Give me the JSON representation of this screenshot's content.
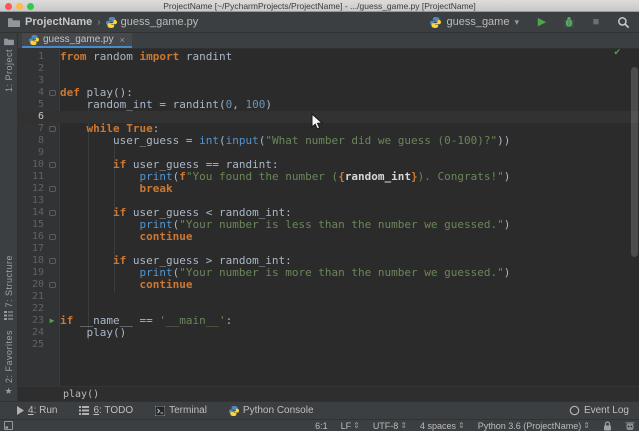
{
  "window": {
    "title": "ProjectName [~/PycharmProjects/ProjectName] - .../guess_game.py [ProjectName]"
  },
  "toolbar": {
    "project": "ProjectName",
    "separator": "›",
    "file": "guess_game.py",
    "run_config": "guess_game"
  },
  "tabs": [
    {
      "label": "guess_game.py"
    }
  ],
  "stripe_left": {
    "project": "1: Project",
    "structure": "7: Structure",
    "favorites": "2: Favorites"
  },
  "icons": {
    "play": "▶",
    "stop": "■",
    "dropdown": "▾",
    "close": "×",
    "check": "✔",
    "star": "★",
    "updown": "⇕"
  },
  "editor": {
    "current_line": 6,
    "gutter_marks": {
      "4": "fold",
      "7": "fold",
      "10": "fold",
      "12": "fold-end",
      "14": "fold",
      "16": "fold-end",
      "18": "fold",
      "20": "fold-end",
      "23": "run"
    },
    "lines": [
      {
        "n": 1,
        "seg": [
          [
            "k",
            "from"
          ],
          [
            "p",
            " random "
          ],
          [
            "k",
            "import"
          ],
          [
            "p",
            " randint"
          ]
        ]
      },
      {
        "n": 2,
        "seg": []
      },
      {
        "n": 3,
        "seg": []
      },
      {
        "n": 4,
        "seg": [
          [
            "k",
            "def"
          ],
          [
            "p",
            " play():"
          ]
        ]
      },
      {
        "n": 5,
        "seg": [
          [
            "p",
            "    random_int = randint("
          ],
          [
            "n",
            "0"
          ],
          [
            "p",
            ", "
          ],
          [
            "n",
            "100"
          ],
          [
            "p",
            ")"
          ]
        ]
      },
      {
        "n": 6,
        "seg": []
      },
      {
        "n": 7,
        "seg": [
          [
            "p",
            "    "
          ],
          [
            "k",
            "while"
          ],
          [
            "p",
            " "
          ],
          [
            "k",
            "True"
          ],
          [
            "p",
            ":"
          ]
        ]
      },
      {
        "n": 8,
        "seg": [
          [
            "p",
            "        user_guess = "
          ],
          [
            "b",
            "int"
          ],
          [
            "p",
            "("
          ],
          [
            "b",
            "input"
          ],
          [
            "p",
            "("
          ],
          [
            "s",
            "\"What number did we guess (0-100)?\""
          ],
          [
            "p",
            "))"
          ]
        ]
      },
      {
        "n": 9,
        "seg": []
      },
      {
        "n": 10,
        "seg": [
          [
            "p",
            "        "
          ],
          [
            "k",
            "if"
          ],
          [
            "p",
            " user_guess == randint:"
          ]
        ]
      },
      {
        "n": 11,
        "seg": [
          [
            "p",
            "            "
          ],
          [
            "b",
            "print"
          ],
          [
            "p",
            "("
          ],
          [
            "k",
            "f"
          ],
          [
            "s",
            "\"You found the number ("
          ],
          [
            "k",
            "{"
          ],
          [
            "e",
            "random_int"
          ],
          [
            "k",
            "}"
          ],
          [
            "s",
            "). Congrats!\""
          ],
          [
            "p",
            ")"
          ]
        ]
      },
      {
        "n": 12,
        "seg": [
          [
            "p",
            "            "
          ],
          [
            "k",
            "break"
          ]
        ]
      },
      {
        "n": 13,
        "seg": []
      },
      {
        "n": 14,
        "seg": [
          [
            "p",
            "        "
          ],
          [
            "k",
            "if"
          ],
          [
            "p",
            " user_guess < random_int:"
          ]
        ]
      },
      {
        "n": 15,
        "seg": [
          [
            "p",
            "            "
          ],
          [
            "b",
            "print"
          ],
          [
            "p",
            "("
          ],
          [
            "s",
            "\"Your number is less than the number we guessed.\""
          ],
          [
            "p",
            ")"
          ]
        ]
      },
      {
        "n": 16,
        "seg": [
          [
            "p",
            "            "
          ],
          [
            "k",
            "continue"
          ]
        ]
      },
      {
        "n": 17,
        "seg": []
      },
      {
        "n": 18,
        "seg": [
          [
            "p",
            "        "
          ],
          [
            "k",
            "if"
          ],
          [
            "p",
            " user_guess > random_int:"
          ]
        ]
      },
      {
        "n": 19,
        "seg": [
          [
            "p",
            "            "
          ],
          [
            "b",
            "print"
          ],
          [
            "p",
            "("
          ],
          [
            "s",
            "\"Your number is more than the number we guessed.\""
          ],
          [
            "p",
            ")"
          ]
        ]
      },
      {
        "n": 20,
        "seg": [
          [
            "p",
            "            "
          ],
          [
            "k",
            "continue"
          ]
        ]
      },
      {
        "n": 21,
        "seg": []
      },
      {
        "n": 22,
        "seg": []
      },
      {
        "n": 23,
        "seg": [
          [
            "k",
            "if"
          ],
          [
            "p",
            " __name__ == "
          ],
          [
            "s",
            "'__main__'"
          ],
          [
            "p",
            ":"
          ]
        ]
      },
      {
        "n": 24,
        "seg": [
          [
            "p",
            "    play()"
          ]
        ]
      },
      {
        "n": 25,
        "seg": []
      }
    ]
  },
  "breadcrumbs": {
    "context": "play()"
  },
  "toolwindow_bar": {
    "run": {
      "mnemonic": "4",
      "rest": ": Run"
    },
    "todo": {
      "mnemonic": "6",
      "rest": ": TODO"
    },
    "terminal": "Terminal",
    "python_console": "Python Console",
    "event_log": "Event Log"
  },
  "statusbar": {
    "position": "6:1",
    "line_sep": "LF",
    "encoding": "UTF-8",
    "indent": "4 spaces",
    "interpreter": "Python 3.6 (ProjectName)"
  },
  "colors": {
    "chrome_bg": "#3C3F41",
    "editor_bg": "#2B2B2B",
    "gutter_bg": "#313335",
    "current_line_bg": "#323232",
    "keyword": "#CC7832",
    "plain": "#A9B7C6",
    "builtin": "#5394CE",
    "string": "#6A8759",
    "number": "#6897BB",
    "expr": "#D8D8D8",
    "accent_run": "#4CA64C",
    "tab_underline": "#4A88C7"
  }
}
